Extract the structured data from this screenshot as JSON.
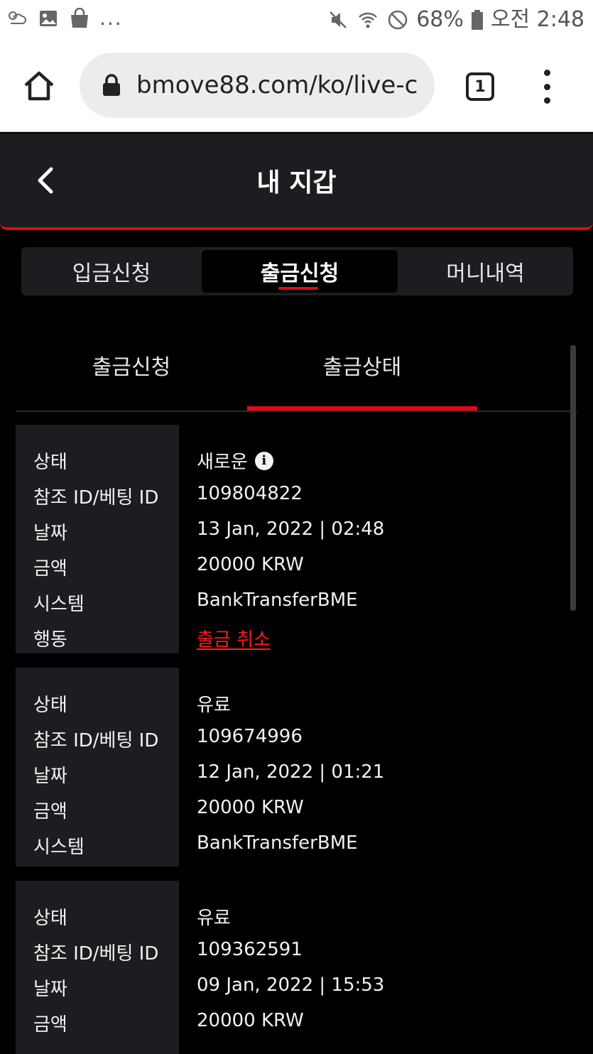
{
  "status_bar": {
    "dots": "...",
    "battery": "68%",
    "time": "오전 2:48"
  },
  "browser": {
    "url": "bmove88.com/ko/live-c",
    "tab_count": "1"
  },
  "header": {
    "title": "내 지갑"
  },
  "main_tabs": [
    "입금신청",
    "출금신청",
    "머니내역"
  ],
  "sub_tabs": [
    "출금신청",
    "출금상태"
  ],
  "records": [
    {
      "rows": [
        {
          "label": "상태",
          "value": "새로운"
        },
        {
          "label": "참조 ID/베팅 ID",
          "value": "109804822"
        },
        {
          "label": "날짜",
          "value": "13 Jan, 2022 | 02:48"
        },
        {
          "label": "금액",
          "value": "20000 KRW"
        },
        {
          "label": "시스템",
          "value": "BankTransferBME"
        },
        {
          "label": "행동",
          "value": "출금 취소"
        }
      ]
    },
    {
      "rows": [
        {
          "label": "상태",
          "value": "유료"
        },
        {
          "label": "참조 ID/베팅 ID",
          "value": "109674996"
        },
        {
          "label": "날짜",
          "value": "12 Jan, 2022 | 01:21"
        },
        {
          "label": "금액",
          "value": "20000 KRW"
        },
        {
          "label": "시스템",
          "value": "BankTransferBME"
        }
      ]
    },
    {
      "rows": [
        {
          "label": "상태",
          "value": "유료"
        },
        {
          "label": "참조 ID/베팅 ID",
          "value": "109362591"
        },
        {
          "label": "날짜",
          "value": "09 Jan, 2022 | 15:53"
        },
        {
          "label": "금액",
          "value": "20000 KRW"
        }
      ]
    }
  ],
  "colors": {
    "accent": "#e50914",
    "panel": "#1c1d21",
    "background": "#000000"
  }
}
